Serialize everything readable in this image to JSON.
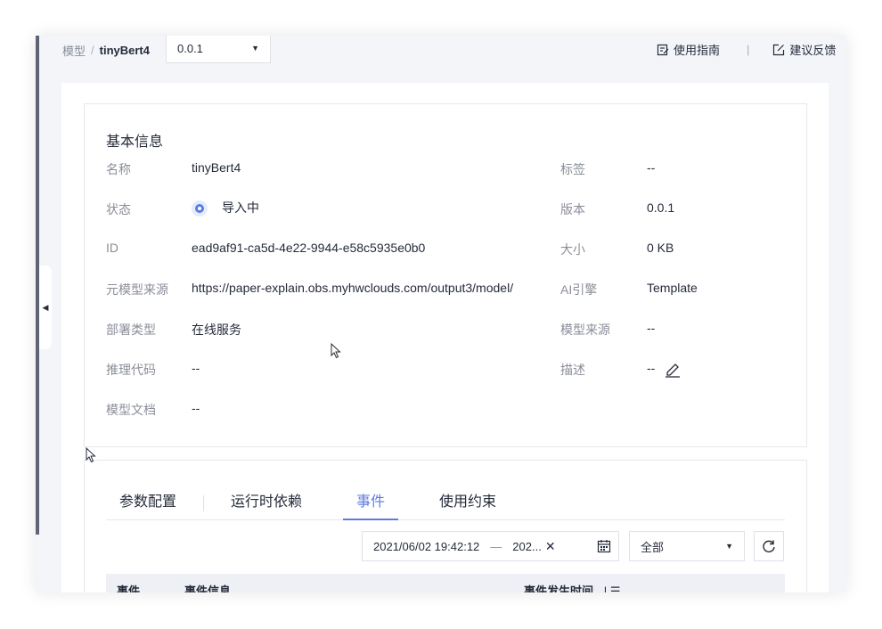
{
  "breadcrumb": {
    "parent": "模型",
    "separator": "/",
    "current": "tinyBert4"
  },
  "version_select": {
    "value": "0.0.1"
  },
  "top_actions": {
    "guide": "使用指南",
    "divider": "|",
    "feedback": "建议反馈"
  },
  "basic_info": {
    "title": "基本信息",
    "left": [
      {
        "key": "名称",
        "value": "tinyBert4"
      },
      {
        "key": "状态",
        "value": "导入中"
      },
      {
        "key": "ID",
        "value": "ead9af91-ca5d-4e22-9944-e58c5935e0b0"
      },
      {
        "key": "元模型来源",
        "value": "https://paper-explain.obs.myhwclouds.com/output3/model/"
      },
      {
        "key": "部署类型",
        "value": "在线服务"
      },
      {
        "key": "推理代码",
        "value": "--"
      },
      {
        "key": "模型文档",
        "value": "--"
      }
    ],
    "right": [
      {
        "key": "标签",
        "value": "--"
      },
      {
        "key": "版本",
        "value": "0.0.1"
      },
      {
        "key": "大小",
        "value": "0 KB"
      },
      {
        "key": "AI引擎",
        "value": "Template"
      },
      {
        "key": "模型来源",
        "value": "--"
      },
      {
        "key": "描述",
        "value": "--"
      }
    ]
  },
  "tabs": [
    {
      "label": "参数配置",
      "active": false
    },
    {
      "label": "运行时依赖",
      "active": false
    },
    {
      "label": "事件",
      "active": true
    },
    {
      "label": "使用约束",
      "active": false
    }
  ],
  "events_filter": {
    "start": "2021/06/02 19:42:12",
    "dash": "—",
    "end": "202...",
    "type_value": "全部"
  },
  "events_table": {
    "columns": [
      "事件...",
      "事件信息",
      "事件发生时间"
    ]
  },
  "colors": {
    "accent": "#5e7ce0",
    "muted": "#8a8e99",
    "text": "#252b3a"
  }
}
